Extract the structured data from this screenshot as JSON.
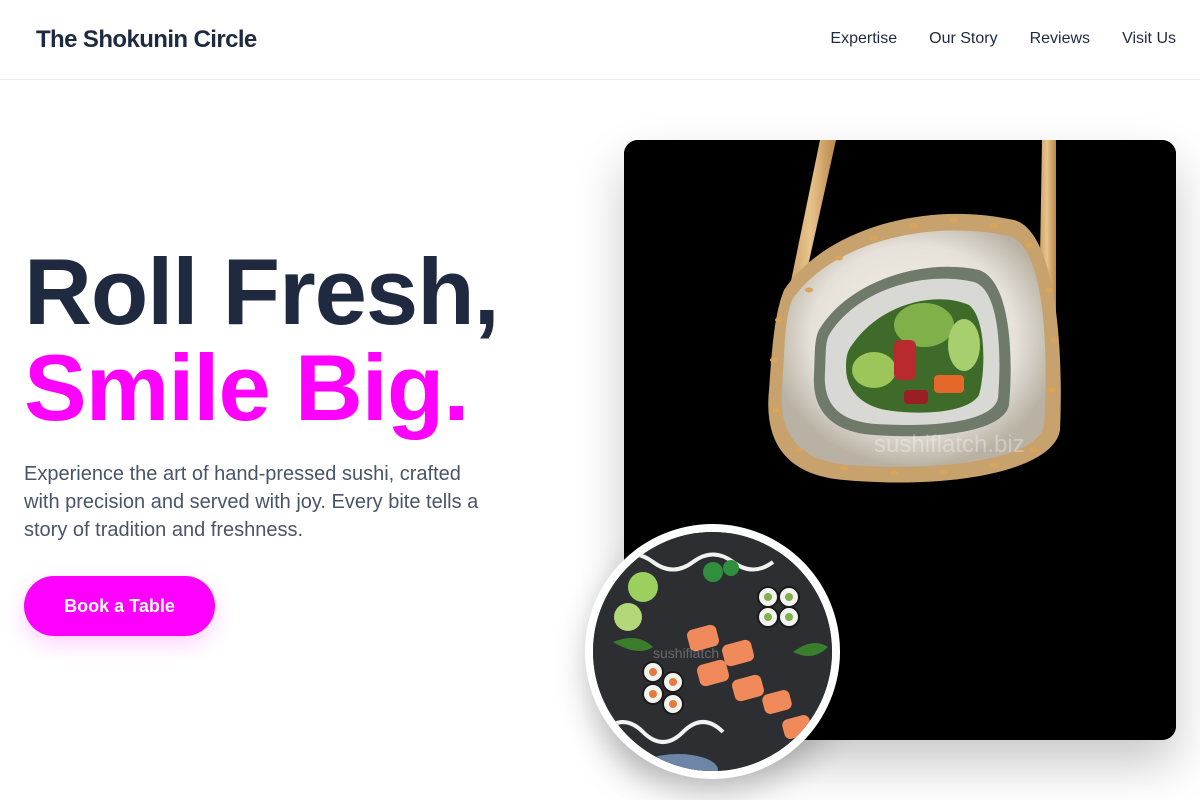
{
  "header": {
    "brand": "The Shokunin Circle",
    "nav": [
      {
        "label": "Expertise"
      },
      {
        "label": "Our Story"
      },
      {
        "label": "Reviews"
      },
      {
        "label": "Visit Us"
      }
    ]
  },
  "hero": {
    "title_line1": "Roll Fresh,",
    "title_line2": "Smile Big.",
    "description": "Experience the art of hand-pressed sushi, crafted with precision and served with joy. Every bite tells a story of tradition and freshness.",
    "cta_label": "Book a Table"
  },
  "images": {
    "main": {
      "subject": "sushi roll held in chopsticks on black background",
      "watermark": "sushiflatch.biz"
    },
    "inset": {
      "subject": "platter of assorted sushi rolls on slate",
      "watermark": "sushiflatch"
    }
  },
  "colors": {
    "brand_dark": "#1f2a40",
    "accent": "#ff00ff",
    "body_text": "#4a5468",
    "image_background": "#000000"
  }
}
